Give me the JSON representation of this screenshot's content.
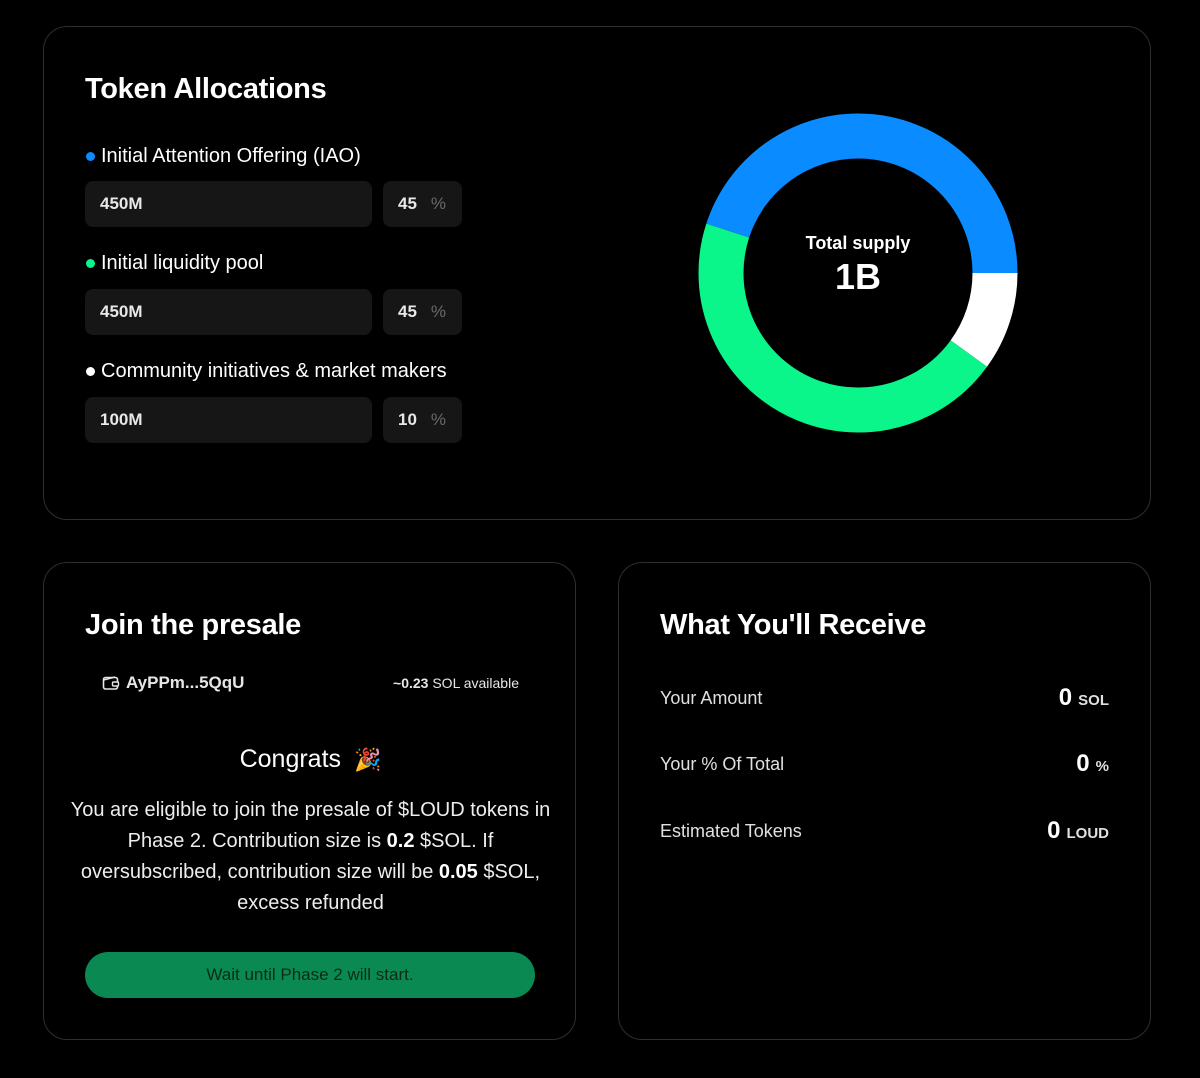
{
  "allocations": {
    "title": "Token Allocations",
    "items": [
      {
        "label": "Initial Attention Offering (IAO)",
        "amount": "450M",
        "percent": "45",
        "percent_sign": "%",
        "color": "#0a8bff",
        "share": 45
      },
      {
        "label": "Initial liquidity pool",
        "amount": "450M",
        "percent": "45",
        "percent_sign": "%",
        "color": "#0af58a",
        "share": 45
      },
      {
        "label": "Community initiatives & market makers",
        "amount": "100M",
        "percent": "10",
        "percent_sign": "%",
        "color": "#ffffff",
        "share": 10
      }
    ],
    "donut": {
      "label": "Total supply",
      "value": "1B"
    }
  },
  "presale": {
    "title": "Join the presale",
    "wallet": "AyPPm...5QqU",
    "available_amount": "~0.23",
    "available_suffix": "SOL available",
    "congrats": "Congrats",
    "congrats_emoji": "🎉",
    "desc_1": "You are eligible to join the presale of $LOUD tokens in Phase 2. Contribution size is ",
    "desc_bold_1": "0.2",
    "desc_2": " $SOL. If oversubscribed, contribution size will be ",
    "desc_bold_2": "0.05",
    "desc_3": " $SOL, excess refunded",
    "button": "Wait until Phase 2 will start."
  },
  "receive": {
    "title": "What You'll Receive",
    "rows": [
      {
        "label": "Your Amount",
        "value": "0",
        "unit": "SOL"
      },
      {
        "label": "Your % Of Total",
        "value": "0",
        "unit": "%"
      },
      {
        "label": "Estimated Tokens",
        "value": "0",
        "unit": "LOUD"
      }
    ]
  }
}
